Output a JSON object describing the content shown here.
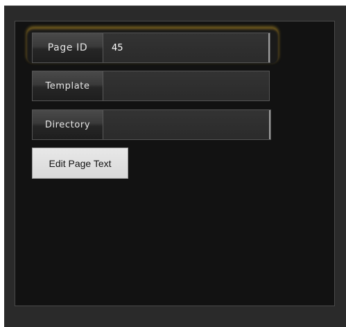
{
  "form": {
    "fields": [
      {
        "label": "Page ID",
        "value": "45"
      },
      {
        "label": "Template",
        "value": ""
      },
      {
        "label": "Directory",
        "value": ""
      }
    ],
    "edit_button_label": "Edit Page Text"
  },
  "colors": {
    "background": "#2a2a2a",
    "panel": "#121212",
    "accent_glow": "#c8a028",
    "button": "#d9d9d9"
  }
}
